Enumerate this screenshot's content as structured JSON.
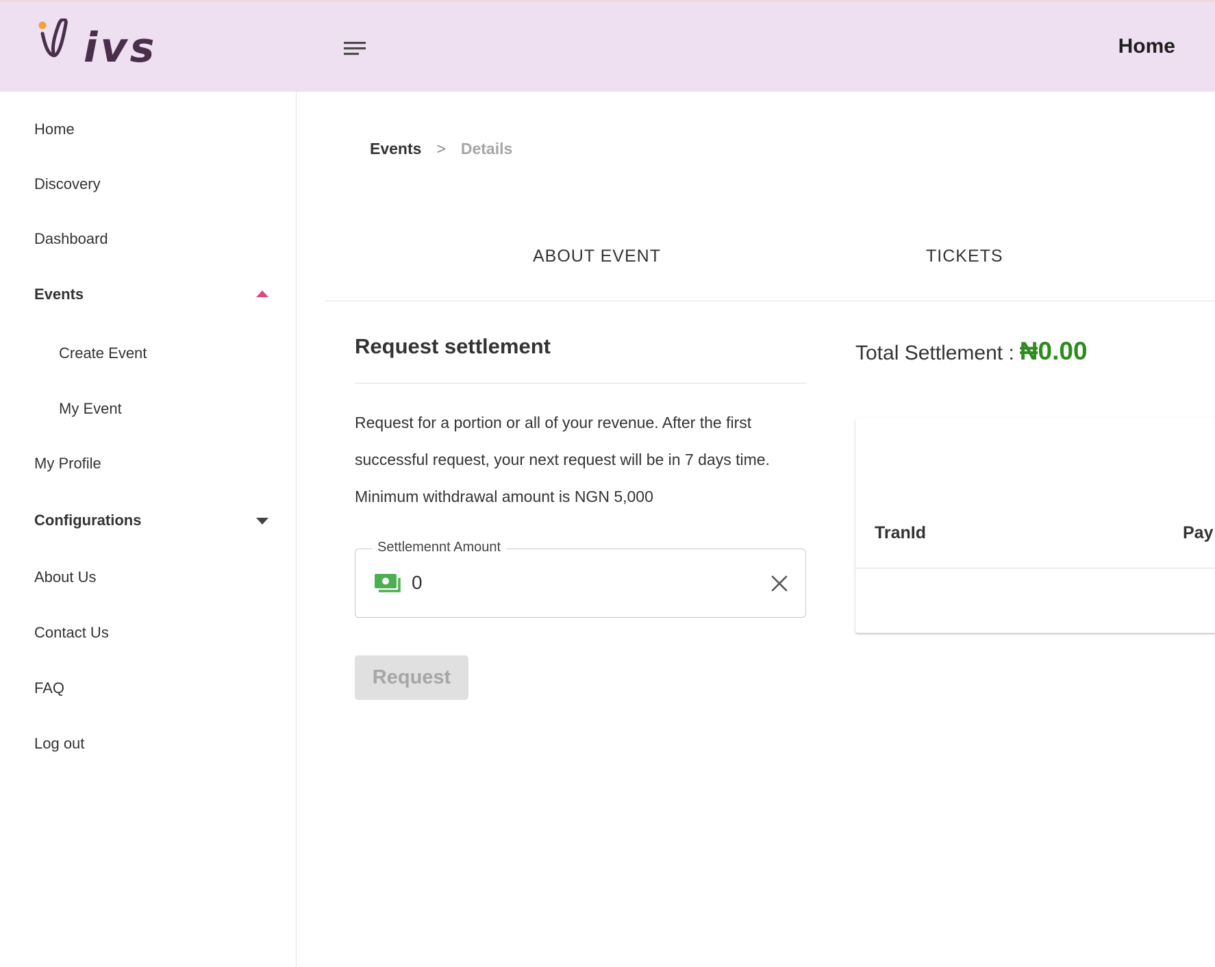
{
  "header": {
    "logo_text": "ivs",
    "title": "Home",
    "accent_color": "#efe0f1"
  },
  "sidebar": {
    "items": [
      {
        "label": "Home"
      },
      {
        "label": "Discovery"
      },
      {
        "label": "Dashboard"
      },
      {
        "label": "Events",
        "expanded": true
      },
      {
        "label": "Create Event",
        "sub": true
      },
      {
        "label": "My Event",
        "sub": true
      },
      {
        "label": "My Profile"
      },
      {
        "label": "Configurations",
        "expanded": false
      },
      {
        "label": "About Us"
      },
      {
        "label": "Contact Us"
      },
      {
        "label": "FAQ"
      },
      {
        "label": "Log out"
      }
    ]
  },
  "breadcrumb": {
    "parent": "Events",
    "separator": ">",
    "current": "Details"
  },
  "tabs": [
    {
      "label": "ABOUT EVENT"
    },
    {
      "label": "TICKETS"
    }
  ],
  "settlement": {
    "title": "Request settlement",
    "description": "Request for a portion or all of your revenue. After the first successful request, your next request will be in 7 days time. Minimum withdrawal amount is NGN 5,000",
    "field_label": "Settlemennt Amount",
    "field_value": "0",
    "button_label": "Request",
    "total_label": "Total Settlement :",
    "total_value": "₦0.00",
    "total_color": "#2e8b1e"
  },
  "table": {
    "columns": [
      "TranId",
      "Pay"
    ]
  },
  "icons": {
    "menu": "hamburger-menu-icon",
    "money": "money-icon",
    "clear": "close-icon",
    "caret_up": "caret-up-icon",
    "caret_down": "caret-down-icon"
  }
}
